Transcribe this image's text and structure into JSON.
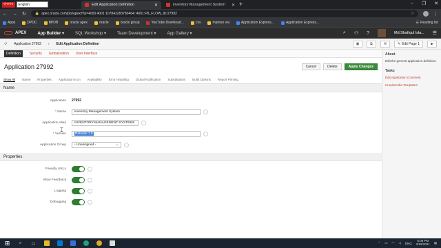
{
  "browser": {
    "ext_label": "বাংলায়",
    "lang_value": "English",
    "tabs": [
      {
        "title": "Edit Application Definition"
      },
      {
        "title": "inventory Management System"
      }
    ],
    "url": "apex.oracle.com/pls/apex/f?p=4000:4001:107843283780464::4001:FB_FLOW_ID:27992",
    "bookmarks": [
      "Apps",
      "DPDC",
      "BPDB",
      "oracle apex",
      "oracle",
      "oracle group",
      "YouTube Download...",
      "css",
      "mamun vai",
      "Application Express...",
      "Application Express..."
    ],
    "reading_list": "Reading list"
  },
  "apex": {
    "brand": "APEX",
    "nav": [
      "App Builder",
      "SQL Workshop",
      "Team Development",
      "App Gallery"
    ],
    "user": "Md.Shafiqul Isla...",
    "breadcrumb": {
      "app": "Application 27992",
      "page": "Edit Application Definition"
    },
    "edit_page": "Edit Page 1"
  },
  "primary_tabs": [
    "Definition",
    "Security",
    "Globalization",
    "User Interface"
  ],
  "page": {
    "title": "Application 27992",
    "buttons": {
      "cancel": "Cancel",
      "delete": "Delete",
      "apply": "Apply Changes"
    }
  },
  "secondary_tabs": [
    "Show All",
    "Name",
    "Properties",
    "Application Icon",
    "Availability",
    "Error Handling",
    "Global Notification",
    "Substitutions",
    "Build Options",
    "Report Printing"
  ],
  "sections": {
    "name": "Name",
    "properties": "Properties"
  },
  "fields": {
    "application": {
      "label": "Application",
      "value": "27992"
    },
    "name": {
      "label": "Name",
      "value": "inventory Management System"
    },
    "alias": {
      "label": "Application Alias",
      "value": "INVENTORY-MANAGEMENT-SYSTEM8"
    },
    "version": {
      "label": "Version",
      "value": "Release 1.0"
    },
    "group": {
      "label": "Application Group",
      "value": "- Unassigned -"
    }
  },
  "properties": [
    {
      "label": "Friendly URLs",
      "on": true
    },
    {
      "label": "Allow Feedback",
      "on": true
    },
    {
      "label": "Logging",
      "on": true
    },
    {
      "label": "Debugging",
      "on": true
    }
  ],
  "side": {
    "about_title": "About",
    "about_text": "Edit the general application definition.",
    "tasks_title": "Tasks",
    "tasks": [
      "Edit Application Comment",
      "Unsubscribe Templates"
    ]
  },
  "taskbar": {
    "time": "6:08 PM",
    "date": "3/19/2021",
    "lang": "ENG"
  },
  "colors": {
    "accent_green": "#3a8a3a",
    "apex_red": "#e03a2e",
    "toggle_on": "#2e7d32"
  }
}
